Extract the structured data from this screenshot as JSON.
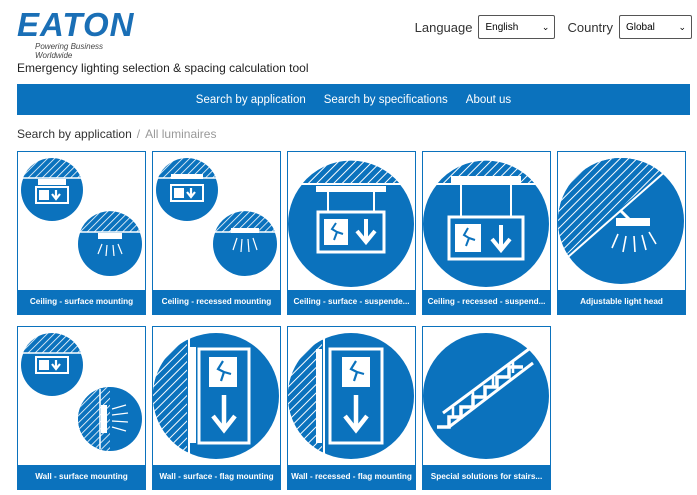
{
  "brand": {
    "logo_text": "EATON",
    "tagline": "Powering Business Worldwide"
  },
  "header": {
    "language_label": "Language",
    "language_value": "English",
    "country_label": "Country",
    "country_value": "Global"
  },
  "app_title": "Emergency lighting selection & spacing calculation tool",
  "nav": {
    "items": [
      {
        "label": "Search by application"
      },
      {
        "label": "Search by specifications"
      },
      {
        "label": "About us"
      }
    ]
  },
  "breadcrumb": {
    "root": "Search by application",
    "separator": "/",
    "current": "All luminaires"
  },
  "cards": [
    {
      "label": "Ceiling - surface mounting",
      "icon": "ceiling-surface-icon"
    },
    {
      "label": "Ceiling - recessed mounting",
      "icon": "ceiling-recessed-icon"
    },
    {
      "label": "Ceiling - surface - suspende...",
      "icon": "ceiling-surface-suspended-icon"
    },
    {
      "label": "Ceiling - recessed - suspend...",
      "icon": "ceiling-recessed-suspended-icon"
    },
    {
      "label": "Adjustable light head",
      "icon": "adjustable-light-head-icon"
    },
    {
      "label": "Wall - surface mounting",
      "icon": "wall-surface-icon"
    },
    {
      "label": "Wall - surface - flag mounting",
      "icon": "wall-surface-flag-icon"
    },
    {
      "label": "Wall - recessed - flag mounting",
      "icon": "wall-recessed-flag-icon"
    },
    {
      "label": "Special solutions  for stairs...",
      "icon": "stairs-icon"
    }
  ],
  "colors": {
    "brand_blue": "#0b72bd",
    "logo_blue": "#1a6fb6"
  }
}
